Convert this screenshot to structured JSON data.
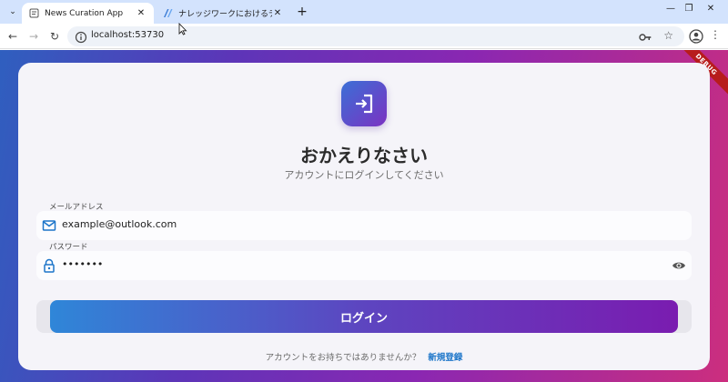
{
  "browser": {
    "tabs": [
      {
        "title": "News Curation App",
        "active": true
      },
      {
        "title": "ナレッジワークにおけるデータ基盤の",
        "active": false
      }
    ],
    "url": "localhost:53730"
  },
  "debug_banner": "DEBUG",
  "login": {
    "heading": "おかえりなさい",
    "subheading": "アカウントにログインしてください",
    "email_label": "メールアドレス",
    "email_value": "example@outlook.com",
    "password_label": "パスワード",
    "password_value": "•••••••",
    "submit_label": "ログイン",
    "signup_prompt": "アカウントをお持ちではありませんか？",
    "signup_link": "新規登録"
  },
  "colors": {
    "accent_blue": "#2f86d8",
    "accent_purple": "#7a1cb0",
    "link": "#1c75c9"
  },
  "icons": [
    "login-icon",
    "email-icon",
    "lock-icon",
    "eye-icon"
  ]
}
